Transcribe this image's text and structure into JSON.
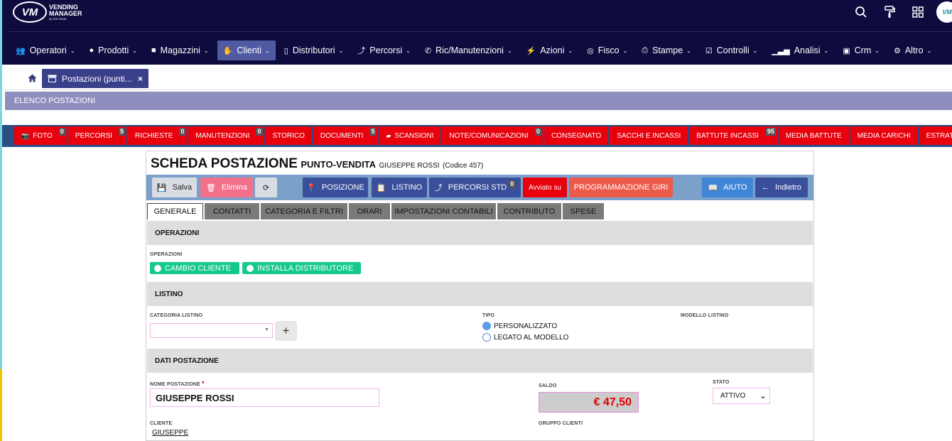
{
  "header": {
    "logo_text": "VM",
    "logo_brand_line1": "VENDING",
    "logo_brand_line2": "MANAGER",
    "logo_brand_small": "by SOLTEAM",
    "icons": [
      "search-icon",
      "paint-roller-icon",
      "apps-grid-icon"
    ],
    "avatar_text": "VM"
  },
  "nav": {
    "items": [
      {
        "label": "Operatori",
        "icon": "users-icon"
      },
      {
        "label": "Prodotti",
        "icon": "apple-icon"
      },
      {
        "label": "Magazzini",
        "icon": "truck-icon"
      },
      {
        "label": "Clienti",
        "icon": "handshake-icon"
      },
      {
        "label": "Distributori",
        "icon": "tablet-icon"
      },
      {
        "label": "Percorsi",
        "icon": "route-icon"
      },
      {
        "label": "Ric/Manutenzioni",
        "icon": "phone-icon"
      },
      {
        "label": "Azioni",
        "icon": "bolt-icon"
      },
      {
        "label": "Fisco",
        "icon": "fisco-icon"
      },
      {
        "label": "Stampe",
        "icon": "print-icon"
      },
      {
        "label": "Controlli",
        "icon": "check-square-icon"
      },
      {
        "label": "Analisi",
        "icon": "chart-icon"
      },
      {
        "label": "Crm",
        "icon": "id-card-icon"
      },
      {
        "label": "Altro",
        "icon": "gear-icon"
      }
    ],
    "active": "Clienti"
  },
  "tabs": {
    "open_tab_label": "Postazioni (punti...",
    "close": "×"
  },
  "page_header": "ELENCO POSTAZIONI",
  "quick_buttons": [
    {
      "label": "FOTO",
      "badge": "0"
    },
    {
      "label": "PERCORSI",
      "badge": "5"
    },
    {
      "label": "RICHIESTE",
      "badge": "0"
    },
    {
      "label": "MANUTENZIONI",
      "badge": "0"
    },
    {
      "label": "STORICO",
      "badge": ""
    },
    {
      "label": "DOCUMENTI",
      "badge": "5"
    },
    {
      "label": "SCANSIONI",
      "badge": ""
    },
    {
      "label": "NOTE/COMUNICAZIONI",
      "badge": "0"
    },
    {
      "label": "CONSEGNATO",
      "badge": ""
    },
    {
      "label": "SACCHI E INCASSI",
      "badge": ""
    },
    {
      "label": "BATTUTE INCASSI",
      "badge": "95"
    },
    {
      "label": "MEDIA BATTUTE",
      "badge": ""
    },
    {
      "label": "MEDIA CARICHI",
      "badge": ""
    },
    {
      "label": "ESTRATTO CONTO",
      "badge": ""
    }
  ],
  "scheda": {
    "title": "SCHEDA POSTAZIONE",
    "subtitle": "PUNTO-VENDITA",
    "client_name": "GIUSEPPE ROSSI",
    "code": "(Codice 457)"
  },
  "actions": {
    "save": "Salva",
    "delete": "Elimina",
    "position": "POSIZIONE",
    "pricelist": "LISTINO",
    "routes_std": "PERCORSI STD",
    "routes_std_badge": "0",
    "started_on": "Avviato su",
    "schedule": "PROGRAMMAZIONE GIRI",
    "help": "AIUTO",
    "back": "Indietro"
  },
  "form_tabs": [
    "GENERALE",
    "CONTATTI",
    "CATEGORIA E FILTRI",
    "ORARI",
    "IMPOSTAZIONI CONTABILI",
    "CONTRIBUTO",
    "SPESE"
  ],
  "sections": {
    "operations": "OPERAZIONI",
    "pricelist": "LISTINO",
    "station_data": "DATI POSTAZIONE"
  },
  "operations": {
    "label": "OPERAZIONI",
    "change_client": "CAMBIO CLIENTE",
    "install_dispenser": "INSTALLA DISTRIBUTORE"
  },
  "pricelist_fields": {
    "category_label": "CATEGORIA LISTINO",
    "category_value": "",
    "add": "+",
    "type_label": "TIPO",
    "type_options": [
      "PERSONALIZZATO",
      "LEGATO AL MODELLO"
    ],
    "type_selected": "PERSONALIZZATO",
    "model_label": "MODELLO LISTINO"
  },
  "station_fields": {
    "name_label": "NOME POSTAZIONE",
    "required_mark": "*",
    "name_value": "GIUSEPPE ROSSI",
    "balance_label": "SALDO",
    "balance_value": "€ 47,50",
    "status_label": "STATO",
    "status_value": "ATTIVO",
    "client_label": "CLIENTE",
    "client_value": "GIUSEPPE",
    "group_label": "GRUPPO CLIENTI"
  },
  "colors": {
    "topbar": "#0e0c3f",
    "active_nav": "#4f5aa3",
    "quick_button": "#e8000d",
    "quick_bar": "#2a4f85",
    "action_bar": "#7ba0c9",
    "navy_button": "#3a4f9b",
    "toggle_green": "#14c98a",
    "balance_red": "#e00000"
  }
}
